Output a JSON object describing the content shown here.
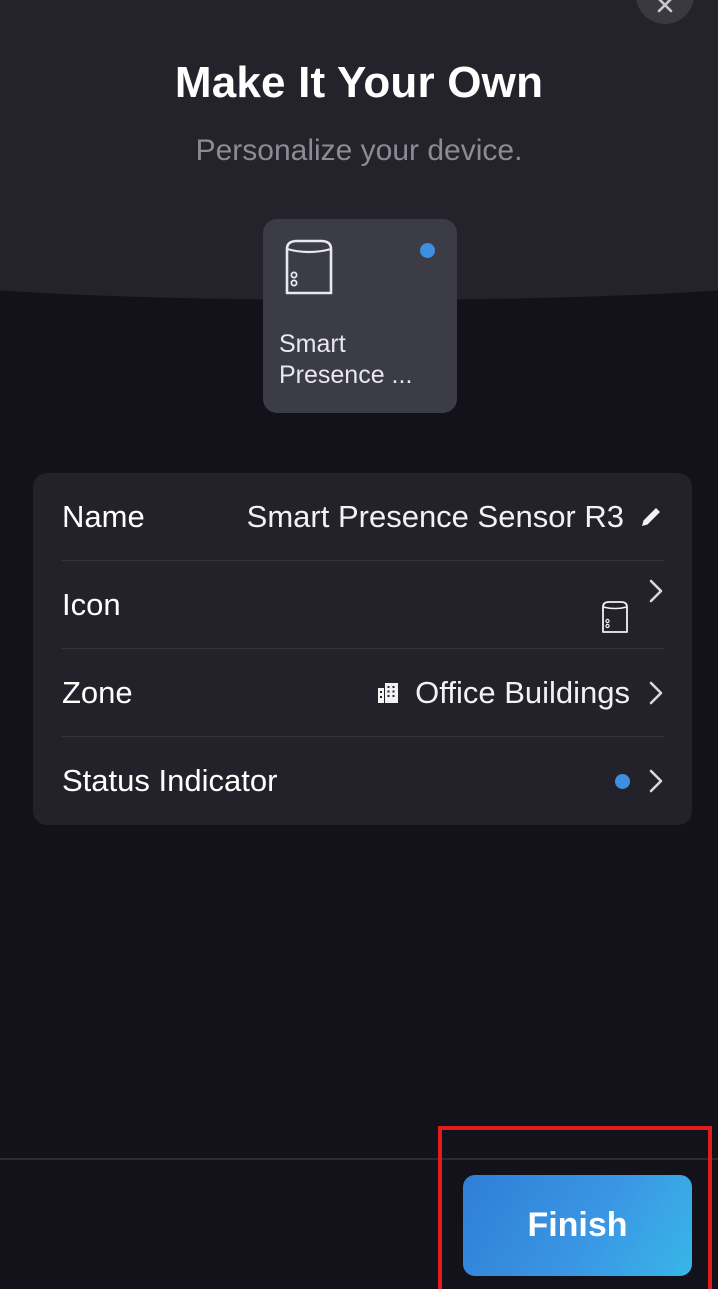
{
  "header": {
    "title": "Make It Your Own",
    "subtitle": "Personalize your device."
  },
  "device_card": {
    "name": "Smart\nPresence ...",
    "icon": "sensor-device-icon",
    "status_color": "#3d8fe0"
  },
  "settings": {
    "name": {
      "label": "Name",
      "value": "Smart Presence Sensor R3",
      "action_icon": "pencil-icon"
    },
    "icon": {
      "label": "Icon",
      "value_icon": "sensor-device-icon"
    },
    "zone": {
      "label": "Zone",
      "value": "Office Buildings",
      "value_icon": "building-icon"
    },
    "status_indicator": {
      "label": "Status Indicator",
      "value_color": "#3d8fe0"
    }
  },
  "footer": {
    "finish_label": "Finish"
  },
  "colors": {
    "accent": "#3d8fe0",
    "background": "#13121a",
    "card": "#23222a",
    "highlight": "#e31b1b"
  }
}
